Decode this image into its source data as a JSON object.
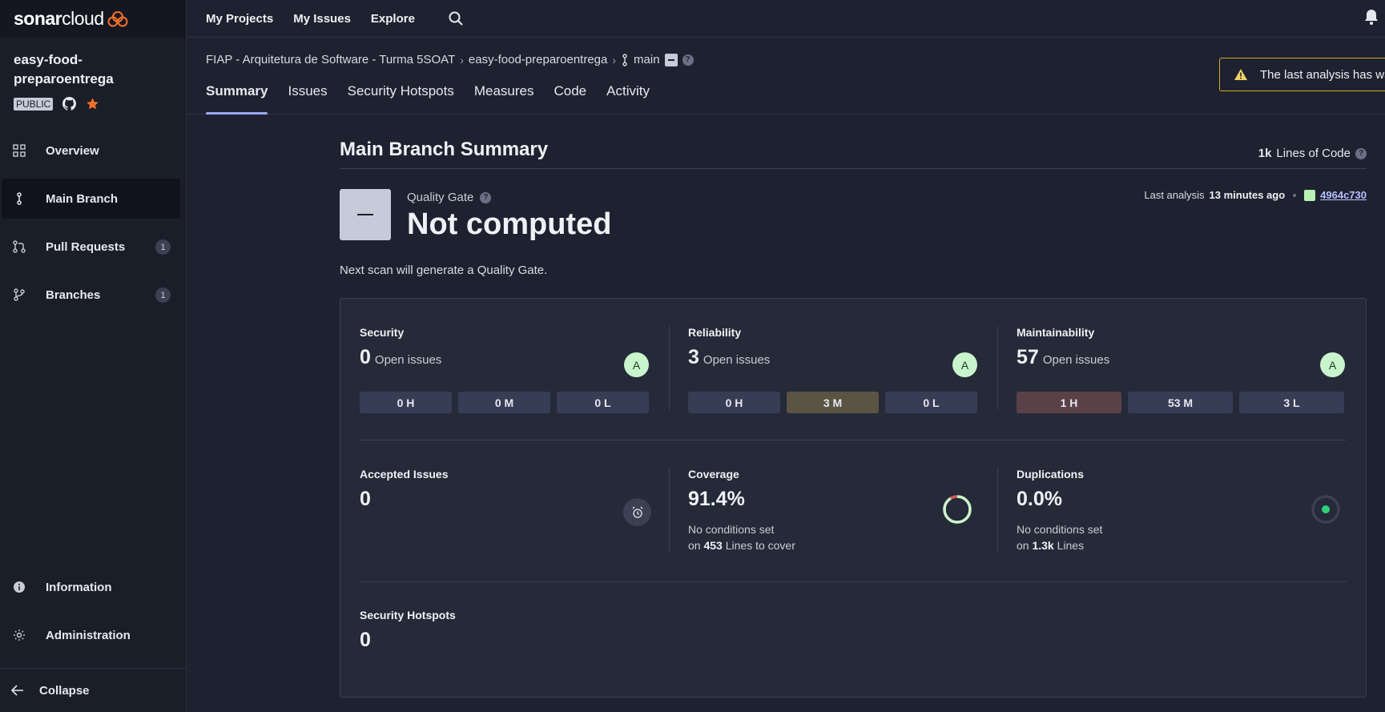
{
  "brand": {
    "bold": "sonar",
    "light": "cloud"
  },
  "project": {
    "name": "easy-food-preparoentrega",
    "visibility": "PUBLIC"
  },
  "sidebar": {
    "items": [
      {
        "label": "Overview"
      },
      {
        "label": "Main Branch"
      },
      {
        "label": "Pull Requests",
        "count": "1"
      },
      {
        "label": "Branches",
        "count": "1"
      }
    ],
    "bottom_items": [
      {
        "label": "Information"
      },
      {
        "label": "Administration"
      }
    ],
    "collapse_label": "Collapse"
  },
  "topnav": {
    "links": [
      "My Projects",
      "My Issues",
      "Explore"
    ]
  },
  "breadcrumb": {
    "org": "FIAP - Arquitetura de Software - Turma 5SOAT",
    "project": "easy-food-preparoentrega",
    "branch": "main"
  },
  "tabs": [
    "Summary",
    "Issues",
    "Security Hotspots",
    "Measures",
    "Code",
    "Activity"
  ],
  "warning_banner": "The last analysis has wa",
  "summary": {
    "title": "Main Branch Summary",
    "loc_value": "1k",
    "loc_label": "Lines of Code",
    "quality_gate_label": "Quality Gate",
    "quality_gate_status": "Not computed",
    "last_analysis_label": "Last analysis",
    "last_analysis_time": "13 minutes ago",
    "commit": "4964c730",
    "next_scan": "Next scan will generate a Quality Gate."
  },
  "metrics": {
    "security": {
      "title": "Security",
      "value": "0",
      "suffix": "Open issues",
      "grade": "A",
      "sev": [
        "0 H",
        "0 M",
        "0 L"
      ]
    },
    "reliability": {
      "title": "Reliability",
      "value": "3",
      "suffix": "Open issues",
      "grade": "A",
      "sev": [
        "0 H",
        "3 M",
        "0 L"
      ]
    },
    "maintainability": {
      "title": "Maintainability",
      "value": "57",
      "suffix": "Open issues",
      "grade": "A",
      "sev": [
        "1 H",
        "53 M",
        "3 L"
      ]
    },
    "accepted": {
      "title": "Accepted Issues",
      "value": "0"
    },
    "coverage": {
      "title": "Coverage",
      "value": "91.4%",
      "line1": "No conditions set",
      "line2_pre": "on",
      "line2_bold": "453",
      "line2_post": "Lines to cover",
      "percent": 91.4
    },
    "duplications": {
      "title": "Duplications",
      "value": "0.0%",
      "line1": "No conditions set",
      "line2_pre": "on",
      "line2_bold": "1.3k",
      "line2_post": "Lines",
      "percent": 0.0
    },
    "hotspots": {
      "title": "Security Hotspots",
      "value": "0"
    }
  },
  "colors": {
    "accent": "#9ea8f0",
    "brand_orange": "#f3702a",
    "warning": "#d4a634",
    "grade_a": "#c9f5cc"
  }
}
